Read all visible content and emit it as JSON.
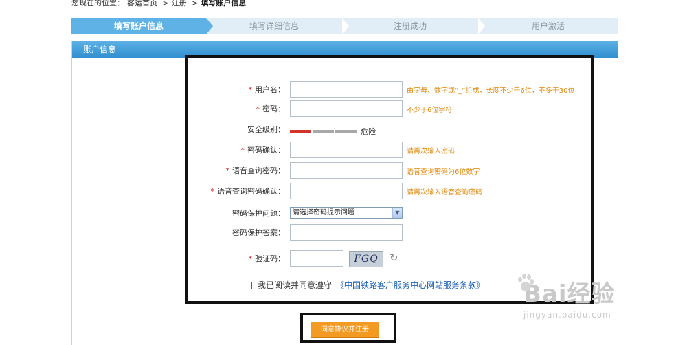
{
  "breadcrumb": {
    "prefix": "您现在的位置：",
    "home": "客运首页",
    "sep": ">",
    "register": "注册",
    "current": "填写账户信息"
  },
  "steps": [
    "填写账户信息",
    "填写详细信息",
    "注册成功",
    "用户激活"
  ],
  "panel": {
    "title": "账户信息"
  },
  "form": {
    "required_mark": "*",
    "username": {
      "label": "用户名：",
      "value": "",
      "hint": "由字母、数字或“_”组成，长度不少于6位，不多于30位"
    },
    "password": {
      "label": "密码：",
      "value": "",
      "hint": "不少于6位字符"
    },
    "security": {
      "label": "安全级别：",
      "level_text": "危险",
      "bars_filled": 1,
      "bars_total": 3
    },
    "password_confirm": {
      "label": "密码确认：",
      "value": "",
      "hint": "请再次输入密码"
    },
    "voice_password": {
      "label": "语音查询密码：",
      "value": "",
      "hint": "语音查询密码为6位数字"
    },
    "voice_password_confirm": {
      "label": "语音查询密码确认：",
      "value": "",
      "hint": "请再次输入语音查询密码"
    },
    "security_question": {
      "label": "密码保护问题：",
      "selected": "请选择密码提示问题"
    },
    "security_answer": {
      "label": "密码保护答案：",
      "value": ""
    },
    "captcha": {
      "label": "验证码：",
      "value": "",
      "image_text": "FGQ"
    }
  },
  "agreement": {
    "text": "我已阅读并同意遵守",
    "link": "《中国铁路客户服务中心网站服务条款》",
    "checked": false
  },
  "submit": {
    "label": "同意协议并注册"
  },
  "watermark": {
    "brand": "Bai经验",
    "url": "jingyan.baidu.com"
  },
  "colors": {
    "accent": "#5fb2e6",
    "hint": "#e08a10",
    "required": "#d21e1e",
    "button": "#f39a22"
  }
}
